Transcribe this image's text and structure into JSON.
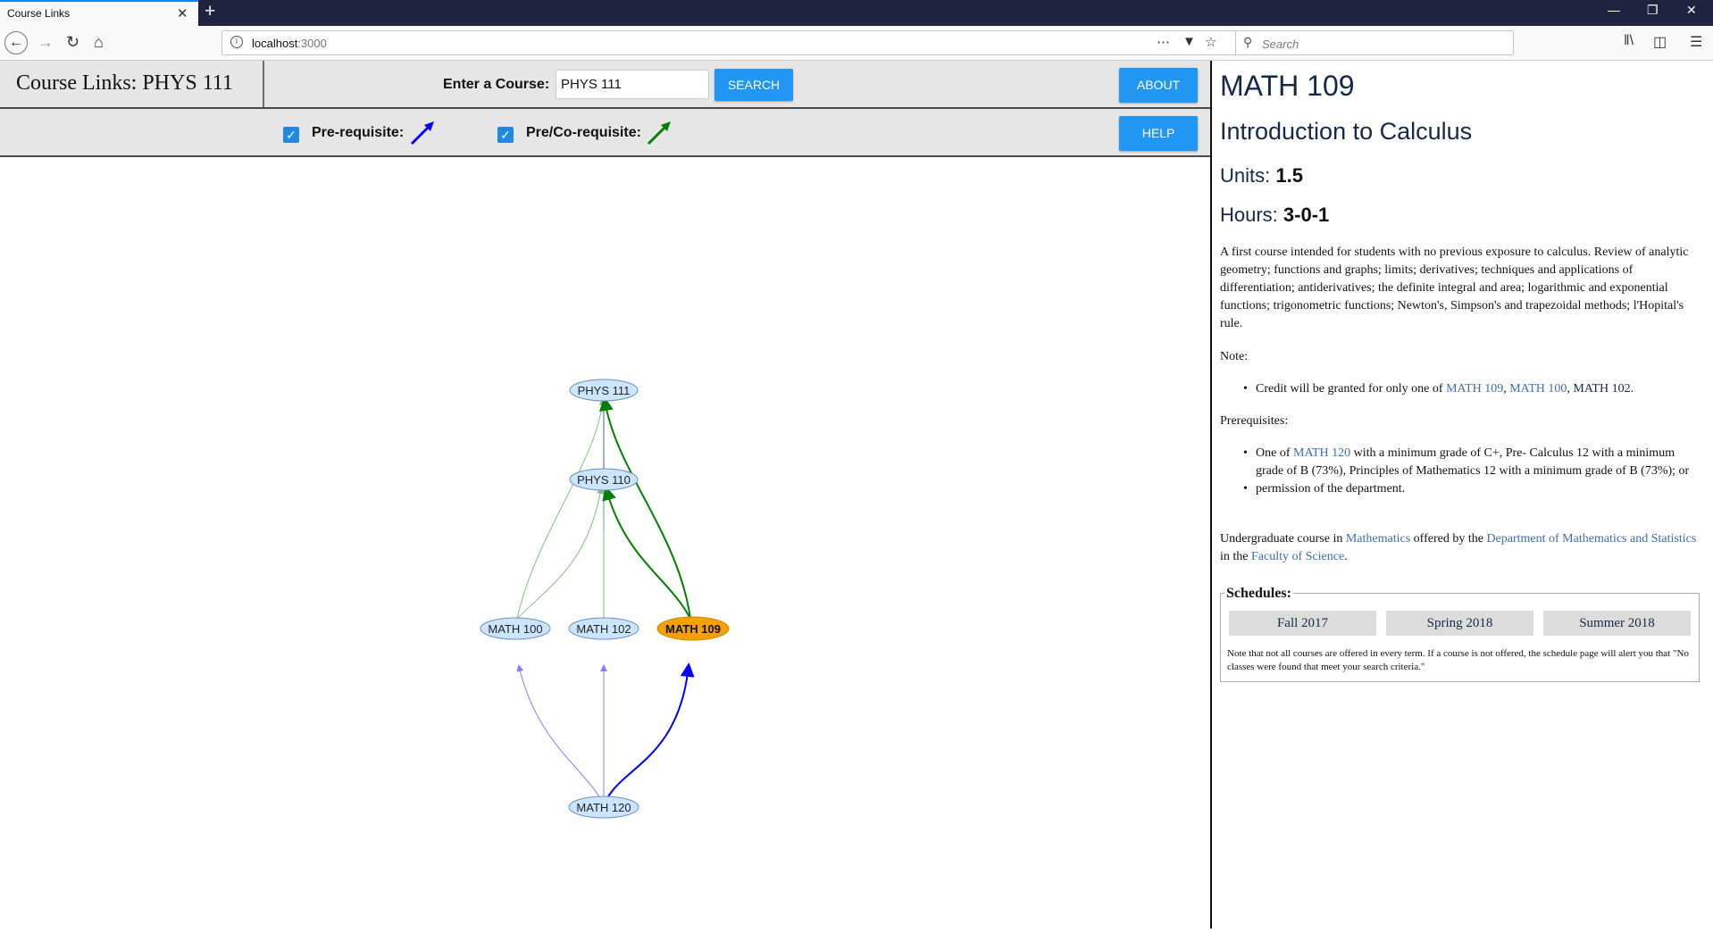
{
  "browser": {
    "tab_title": "Course Links",
    "tab_close": "✕",
    "new_tab": "+",
    "url_host": "localhost",
    "url_port": ":3000",
    "search_placeholder": "Search",
    "window_min": "—",
    "window_restore": "❐",
    "window_close": "✕"
  },
  "header": {
    "title": "Course Links: PHYS 111",
    "course_label": "Enter a Course:",
    "course_value": "PHYS 111",
    "search_button": "SEARCH",
    "about_button": "ABOUT"
  },
  "legend": {
    "prereq_label": "Pre-requisite:",
    "coreq_label": "Pre/Co-requisite:",
    "prereq_color": "#0000ff",
    "coreq_color": "#008000",
    "help_button": "HELP"
  },
  "graph": {
    "nodes": [
      {
        "id": "PHYS 111",
        "label": "PHYS 111",
        "selected": false
      },
      {
        "id": "PHYS 110",
        "label": "PHYS 110",
        "selected": false
      },
      {
        "id": "MATH 100",
        "label": "MATH 100",
        "selected": false
      },
      {
        "id": "MATH 102",
        "label": "MATH 102",
        "selected": false
      },
      {
        "id": "MATH 109",
        "label": "MATH 109",
        "selected": true
      },
      {
        "id": "MATH 120",
        "label": "MATH 120",
        "selected": false
      }
    ],
    "node_fill": "#cce5ff",
    "selected_fill": "#f5a000"
  },
  "course": {
    "code": "MATH 109",
    "name": "Introduction to Calculus",
    "units_label": "Units:",
    "units_value": "1.5",
    "hours_label": "Hours:",
    "hours_value": "3-0-1",
    "description": "A first course intended for students with no previous exposure to calculus. Review of analytic geometry; functions and graphs; limits; derivatives; techniques and applications of differentiation; antiderivatives; the definite integral and area; logarithmic and exponential functions; trigonometric functions; Newton's, Simpson's and trapezoidal methods; l'Hopital's rule.",
    "note_heading": "Note:",
    "note_prefix": "Credit will be granted for only one of ",
    "note_link1": "MATH 109",
    "note_sep1": ", ",
    "note_link2": "MATH 100",
    "note_sep2": ", ",
    "note_link3": "MATH 102",
    "note_suffix": ".",
    "prereq_heading": "Prerequisites:",
    "prereq_prefix": "One of ",
    "prereq_link": "MATH 120",
    "prereq_suffix": " with a minimum grade of C+, Pre- Calculus 12 with a minimum grade of B (73%), Principles of Mathematics 12 with a minimum grade of B (73%); or",
    "prereq_item2": "permission of the department.",
    "offer_prefix": "Undergraduate course in ",
    "offer_subject": "Mathematics",
    "offer_mid": " offered by the ",
    "offer_dept": "Department of Mathematics and Statistics",
    "offer_mid2": " in the ",
    "offer_faculty": "Faculty of Science",
    "offer_suffix": "."
  },
  "schedules": {
    "title": "Schedules:",
    "terms": [
      "Fall 2017",
      "Spring 2018",
      "Summer 2018"
    ],
    "note": "Note that not all courses are offered in every term. If a course is not offered, the schedule page will alert you that \"No classes were found that meet your search criteria.\""
  }
}
